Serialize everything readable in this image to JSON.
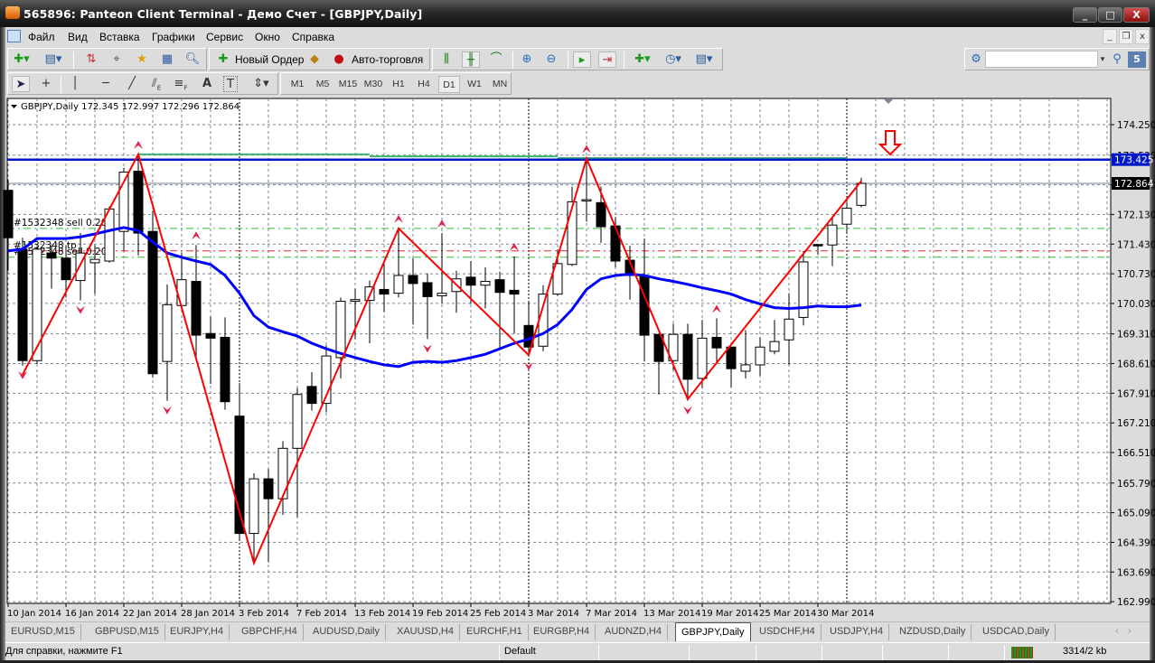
{
  "window": {
    "title": "565896: Panteon Client Terminal - Демо Счет - [GBPJPY,Daily]",
    "controls": {
      "minimize": "_",
      "maximize": "□",
      "close": "X"
    }
  },
  "menu": {
    "items": [
      "Файл",
      "Вид",
      "Вставка",
      "Графики",
      "Сервис",
      "Окно",
      "Справка"
    ],
    "mdi": {
      "minimize": "_",
      "restore": "❐",
      "close": "x"
    }
  },
  "toolbar": {
    "new_order_label": "Новый Ордер",
    "autotrading_label": "Авто-торговля",
    "search_value": "",
    "notifications_badge": "5",
    "timeframes": [
      "M1",
      "M5",
      "M15",
      "M30",
      "H1",
      "H4",
      "D1",
      "W1",
      "MN"
    ],
    "active_timeframe": "D1",
    "drawing_tools": {
      "fibo_channel_sub": "E",
      "fibo_sub": "F",
      "text": "A",
      "label": "T"
    }
  },
  "chart_data": {
    "type": "candlestick",
    "header": {
      "symbol_tf": "GBPJPY,Daily",
      "open": "172.345",
      "high": "172.997",
      "low": "172.296",
      "close": "172.864"
    },
    "ylim": [
      162.95,
      174.87
    ],
    "yticks": [
      "174.250",
      "173.530",
      "172.830",
      "172.130",
      "171.430",
      "170.730",
      "170.030",
      "169.310",
      "168.610",
      "167.910",
      "167.210",
      "166.510",
      "165.790",
      "165.090",
      "164.390",
      "163.690",
      "162.990"
    ],
    "price_labels": {
      "bid": "172.864",
      "level": "173.425"
    },
    "date_labels": [
      {
        "bar": 0,
        "label": "10 Jan 2014"
      },
      {
        "bar": 4,
        "label": "16 Jan 2014"
      },
      {
        "bar": 8,
        "label": "22 Jan 2014"
      },
      {
        "bar": 12,
        "label": "28 Jan 2014"
      },
      {
        "bar": 16,
        "label": "3 Feb 2014"
      },
      {
        "bar": 20,
        "label": "7 Feb 2014"
      },
      {
        "bar": 24,
        "label": "13 Feb 2014"
      },
      {
        "bar": 28,
        "label": "19 Feb 2014"
      },
      {
        "bar": 32,
        "label": "25 Feb 2014"
      },
      {
        "bar": 36,
        "label": "3 Mar 2014"
      },
      {
        "bar": 40,
        "label": "7 Mar 2014"
      },
      {
        "bar": 44,
        "label": "13 Mar 2014"
      },
      {
        "bar": 48,
        "label": "19 Mar 2014"
      },
      {
        "bar": 52,
        "label": "25 Mar 2014"
      },
      {
        "bar": 56,
        "label": "30 Mar 2014"
      }
    ],
    "period_separators": [
      16,
      36,
      58
    ],
    "candles": [
      [
        172.7,
        172.96,
        170.8,
        171.58
      ],
      [
        171.31,
        171.58,
        168.56,
        168.68
      ],
      [
        168.68,
        171.37,
        168.6,
        171.31
      ],
      [
        171.22,
        171.4,
        170.38,
        171.1
      ],
      [
        171.1,
        171.4,
        170.17,
        170.59
      ],
      [
        170.57,
        171.69,
        170.1,
        171.22
      ],
      [
        170.99,
        171.41,
        170.25,
        171.07
      ],
      [
        171.03,
        172.32,
        170.99,
        172.26
      ],
      [
        171.73,
        173.23,
        171.27,
        173.13
      ],
      [
        173.15,
        173.55,
        171.16,
        171.69
      ],
      [
        171.73,
        172.22,
        168.28,
        168.37
      ],
      [
        168.66,
        170.48,
        167.73,
        170.0
      ],
      [
        169.98,
        171.22,
        169.9,
        170.59
      ],
      [
        170.55,
        171.41,
        168.77,
        169.28
      ],
      [
        169.32,
        169.72,
        168.13,
        169.21
      ],
      [
        169.23,
        169.7,
        167.52,
        167.71
      ],
      [
        167.37,
        168.15,
        164.45,
        164.6
      ],
      [
        164.6,
        166.02,
        163.96,
        165.89
      ],
      [
        165.89,
        166.12,
        163.92,
        165.42
      ],
      [
        165.42,
        166.78,
        165.04,
        166.61
      ],
      [
        166.61,
        168.03,
        164.98,
        167.88
      ],
      [
        168.07,
        168.41,
        167.5,
        167.67
      ],
      [
        167.67,
        169.04,
        167.46,
        168.79
      ],
      [
        168.75,
        170.17,
        168.26,
        170.08
      ],
      [
        170.08,
        170.38,
        169.19,
        170.12
      ],
      [
        170.1,
        170.57,
        169.09,
        170.42
      ],
      [
        170.36,
        171.01,
        169.83,
        170.25
      ],
      [
        170.27,
        171.8,
        170.17,
        170.69
      ],
      [
        170.69,
        171.1,
        169.53,
        170.5
      ],
      [
        170.52,
        170.74,
        169.19,
        170.19
      ],
      [
        170.21,
        171.69,
        170.04,
        170.27
      ],
      [
        170.31,
        170.8,
        169.81,
        170.61
      ],
      [
        170.65,
        171.03,
        170.02,
        170.46
      ],
      [
        170.46,
        170.88,
        169.91,
        170.55
      ],
      [
        170.59,
        170.78,
        168.99,
        170.29
      ],
      [
        170.34,
        171.14,
        169.32,
        170.25
      ],
      [
        169.51,
        170.06,
        168.77,
        169.0
      ],
      [
        169.02,
        170.46,
        168.9,
        170.25
      ],
      [
        170.25,
        171.31,
        170.21,
        170.97
      ],
      [
        170.95,
        172.79,
        170.91,
        172.43
      ],
      [
        172.45,
        173.45,
        171.96,
        172.48
      ],
      [
        172.41,
        172.79,
        171.46,
        171.84
      ],
      [
        171.86,
        172.07,
        170.88,
        171.03
      ],
      [
        171.05,
        171.39,
        170.12,
        170.69
      ],
      [
        170.69,
        171.56,
        168.66,
        169.28
      ],
      [
        169.3,
        169.3,
        167.88,
        168.66
      ],
      [
        168.68,
        169.55,
        168.45,
        169.3
      ],
      [
        169.3,
        169.55,
        167.73,
        168.24
      ],
      [
        168.26,
        169.64,
        168.03,
        169.21
      ],
      [
        169.23,
        169.68,
        168.62,
        168.98
      ],
      [
        169.0,
        169.0,
        168.05,
        168.49
      ],
      [
        168.43,
        169.4,
        168.26,
        168.58
      ],
      [
        168.58,
        169.23,
        168.32,
        169.0
      ],
      [
        168.9,
        169.64,
        168.83,
        169.13
      ],
      [
        169.17,
        170.27,
        168.58,
        169.66
      ],
      [
        169.7,
        171.27,
        169.51,
        171.01
      ],
      [
        171.42,
        171.42,
        171.18,
        171.39
      ],
      [
        171.41,
        172.05,
        170.91,
        171.88
      ],
      [
        171.9,
        172.43,
        171.69,
        172.28
      ],
      [
        172.345,
        172.997,
        172.296,
        172.864
      ]
    ],
    "moving_average": [
      171.27,
      171.31,
      171.56,
      171.56,
      171.56,
      171.6,
      171.67,
      171.75,
      171.82,
      171.75,
      171.48,
      171.22,
      171.12,
      171.03,
      170.95,
      170.69,
      170.27,
      169.74,
      169.47,
      169.36,
      169.26,
      169.09,
      168.96,
      168.85,
      168.75,
      168.66,
      168.58,
      168.54,
      168.64,
      168.66,
      168.64,
      168.68,
      168.75,
      168.83,
      168.96,
      169.09,
      169.19,
      169.32,
      169.53,
      169.89,
      170.36,
      170.61,
      170.69,
      170.72,
      170.69,
      170.61,
      170.55,
      170.48,
      170.4,
      170.33,
      170.25,
      170.12,
      170.02,
      169.93,
      169.91,
      169.93,
      169.97,
      169.95,
      169.95,
      169.99
    ],
    "zigzag": [
      [
        1,
        168.35
      ],
      [
        9,
        173.55
      ],
      [
        17,
        163.9
      ],
      [
        27,
        171.8
      ],
      [
        36,
        168.81
      ],
      [
        40,
        173.45
      ],
      [
        47,
        167.77
      ],
      [
        59,
        172.92
      ]
    ],
    "fractal_up": [
      9,
      13,
      27,
      30,
      35,
      40,
      49
    ],
    "fractal_down": [
      1,
      5,
      11,
      29,
      36,
      47
    ],
    "levels": {
      "resistance": 173.425,
      "bid": 172.864
    },
    "trend_line_steps": [
      [
        9,
        173.55
      ],
      [
        25,
        173.5
      ],
      [
        38,
        173.46
      ],
      [
        58,
        173.43
      ],
      [
        69,
        173.42
      ]
    ],
    "orders": [
      {
        "label": "#1532348 sell 0.20",
        "price": 171.8,
        "color": "#33bb33"
      },
      {
        "label": "#1532348 tp",
        "price": 171.27,
        "color": "#ee2222"
      },
      {
        "label": "#1532348 sell 0.20",
        "price": 171.12,
        "color": "#33bb33"
      }
    ],
    "colors": {
      "zigzag": "#ff0000",
      "ma": "#0000ff",
      "level": "#0018c8",
      "trend": "#3cb371",
      "grid": "#7a8595",
      "marker": "#e0204a"
    }
  },
  "tabs": {
    "items": [
      "EURUSD,M15",
      "GBPUSD,M15",
      "EURJPY,H4",
      "GBPCHF,H4",
      "AUDUSD,Daily",
      "XAUUSD,H4",
      "EURCHF,H1",
      "EURGBP,H4",
      "AUDNZD,H4",
      "GBPJPY,Daily",
      "USDCHF,H4",
      "USDJPY,H4",
      "NZDUSD,Daily",
      "USDCAD,Daily"
    ],
    "active": "GBPJPY,Daily"
  },
  "statusbar": {
    "help": "Для справки, нажмите F1",
    "profile": "Default",
    "traffic": "3314/2 kb"
  }
}
